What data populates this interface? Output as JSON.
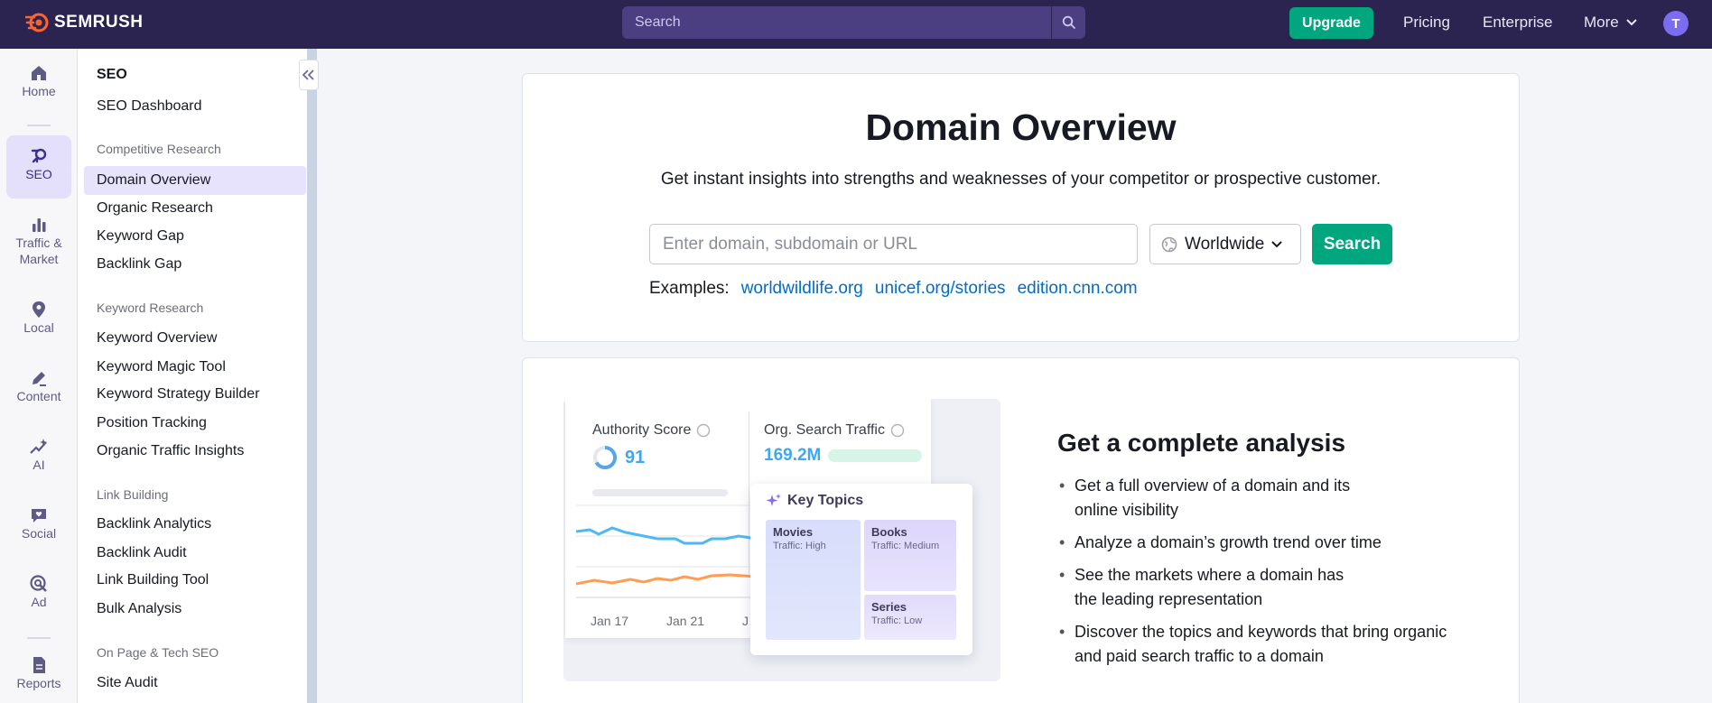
{
  "topbar": {
    "brand": "SEMRUSH",
    "search_placeholder": "Search",
    "upgrade_label": "Upgrade",
    "links": [
      "Pricing",
      "Enterprise",
      "More"
    ],
    "avatar_initial": "T"
  },
  "rail": {
    "items": [
      {
        "label": "Home",
        "icon": "home-icon"
      },
      {
        "label": "SEO",
        "icon": "seo-icon",
        "active": true
      },
      {
        "label": "Traffic &",
        "label2": "Market",
        "icon": "bar-chart-icon"
      },
      {
        "label": "Local",
        "icon": "location-pin-icon"
      },
      {
        "label": "Content",
        "icon": "pencil-icon"
      },
      {
        "label": "AI",
        "icon": "sparkle-icon"
      },
      {
        "label": "Social",
        "icon": "heart-chat-icon"
      },
      {
        "label": "Ad",
        "icon": "target-cursor-icon"
      },
      {
        "label": "Reports",
        "icon": "report-icon"
      }
    ]
  },
  "nav": {
    "title": "SEO",
    "dashboard": "SEO Dashboard",
    "groups": [
      {
        "name": "Competitive Research",
        "items": [
          "Domain Overview",
          "Organic Research",
          "Keyword Gap",
          "Backlink Gap"
        ]
      },
      {
        "name": "Keyword Research",
        "items": [
          "Keyword Overview",
          "Keyword Magic Tool",
          "Keyword Strategy Builder",
          "Position Tracking",
          "Organic Traffic Insights"
        ]
      },
      {
        "name": "Link Building",
        "items": [
          "Backlink Analytics",
          "Backlink Audit",
          "Link Building Tool",
          "Bulk Analysis"
        ]
      },
      {
        "name": "On Page & Tech SEO",
        "items": [
          "Site Audit"
        ]
      }
    ],
    "active_item": "Domain Overview"
  },
  "hero": {
    "title": "Domain Overview",
    "subtitle": "Get instant insights into strengths and weaknesses of your competitor or prospective customer.",
    "input_placeholder": "Enter domain, subdomain or URL",
    "region": "Worldwide",
    "search_label": "Search",
    "examples_label": "Examples:",
    "examples": [
      "worldwildlife.org",
      "unicef.org/stories",
      "edition.cnn.com"
    ]
  },
  "illustration": {
    "authority_label": "Authority Score",
    "authority_value": "91",
    "traffic_label": "Org. Search Traffic",
    "traffic_value": "169.2M",
    "x_ticks": [
      "Jan 17",
      "Jan 21",
      "J"
    ],
    "key_topics_title": "Key Topics",
    "topics": [
      {
        "name": "Movies",
        "traffic": "Traffic: High"
      },
      {
        "name": "Books",
        "traffic": "Traffic: Medium"
      },
      {
        "name": "Series",
        "traffic": "Traffic: Low"
      }
    ]
  },
  "analysis": {
    "title": "Get a complete analysis",
    "bullets": [
      [
        "Get a full overview of a domain and its",
        "online visibility"
      ],
      [
        "Analyze a domain’s growth trend over time"
      ],
      [
        "See the markets where a domain has",
        "the leading representation"
      ],
      [
        "Discover the topics and keywords that bring organic",
        "and paid search traffic to a domain"
      ]
    ]
  },
  "colors": {
    "topbar": "#2b2350",
    "accent_green": "#00a67e",
    "link_blue": "#006dca",
    "active_nav": "#e7e3fc"
  }
}
